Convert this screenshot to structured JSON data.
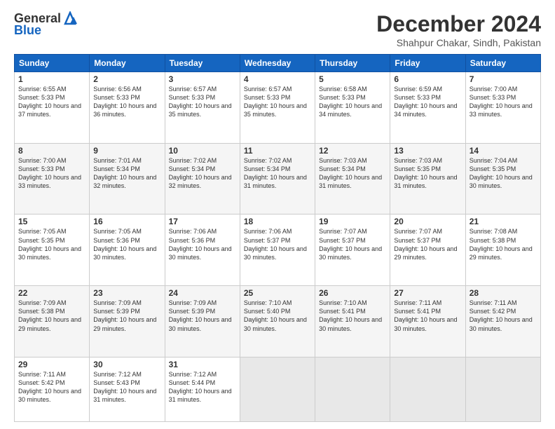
{
  "header": {
    "logo_general": "General",
    "logo_blue": "Blue",
    "month": "December 2024",
    "location": "Shahpur Chakar, Sindh, Pakistan"
  },
  "days_of_week": [
    "Sunday",
    "Monday",
    "Tuesday",
    "Wednesday",
    "Thursday",
    "Friday",
    "Saturday"
  ],
  "weeks": [
    [
      {
        "day": "1",
        "sunrise": "6:55 AM",
        "sunset": "5:33 PM",
        "daylight": "10 hours and 37 minutes."
      },
      {
        "day": "2",
        "sunrise": "6:56 AM",
        "sunset": "5:33 PM",
        "daylight": "10 hours and 36 minutes."
      },
      {
        "day": "3",
        "sunrise": "6:57 AM",
        "sunset": "5:33 PM",
        "daylight": "10 hours and 35 minutes."
      },
      {
        "day": "4",
        "sunrise": "6:57 AM",
        "sunset": "5:33 PM",
        "daylight": "10 hours and 35 minutes."
      },
      {
        "day": "5",
        "sunrise": "6:58 AM",
        "sunset": "5:33 PM",
        "daylight": "10 hours and 34 minutes."
      },
      {
        "day": "6",
        "sunrise": "6:59 AM",
        "sunset": "5:33 PM",
        "daylight": "10 hours and 34 minutes."
      },
      {
        "day": "7",
        "sunrise": "7:00 AM",
        "sunset": "5:33 PM",
        "daylight": "10 hours and 33 minutes."
      }
    ],
    [
      {
        "day": "8",
        "sunrise": "7:00 AM",
        "sunset": "5:33 PM",
        "daylight": "10 hours and 33 minutes."
      },
      {
        "day": "9",
        "sunrise": "7:01 AM",
        "sunset": "5:34 PM",
        "daylight": "10 hours and 32 minutes."
      },
      {
        "day": "10",
        "sunrise": "7:02 AM",
        "sunset": "5:34 PM",
        "daylight": "10 hours and 32 minutes."
      },
      {
        "day": "11",
        "sunrise": "7:02 AM",
        "sunset": "5:34 PM",
        "daylight": "10 hours and 31 minutes."
      },
      {
        "day": "12",
        "sunrise": "7:03 AM",
        "sunset": "5:34 PM",
        "daylight": "10 hours and 31 minutes."
      },
      {
        "day": "13",
        "sunrise": "7:03 AM",
        "sunset": "5:35 PM",
        "daylight": "10 hours and 31 minutes."
      },
      {
        "day": "14",
        "sunrise": "7:04 AM",
        "sunset": "5:35 PM",
        "daylight": "10 hours and 30 minutes."
      }
    ],
    [
      {
        "day": "15",
        "sunrise": "7:05 AM",
        "sunset": "5:35 PM",
        "daylight": "10 hours and 30 minutes."
      },
      {
        "day": "16",
        "sunrise": "7:05 AM",
        "sunset": "5:36 PM",
        "daylight": "10 hours and 30 minutes."
      },
      {
        "day": "17",
        "sunrise": "7:06 AM",
        "sunset": "5:36 PM",
        "daylight": "10 hours and 30 minutes."
      },
      {
        "day": "18",
        "sunrise": "7:06 AM",
        "sunset": "5:37 PM",
        "daylight": "10 hours and 30 minutes."
      },
      {
        "day": "19",
        "sunrise": "7:07 AM",
        "sunset": "5:37 PM",
        "daylight": "10 hours and 30 minutes."
      },
      {
        "day": "20",
        "sunrise": "7:07 AM",
        "sunset": "5:37 PM",
        "daylight": "10 hours and 29 minutes."
      },
      {
        "day": "21",
        "sunrise": "7:08 AM",
        "sunset": "5:38 PM",
        "daylight": "10 hours and 29 minutes."
      }
    ],
    [
      {
        "day": "22",
        "sunrise": "7:09 AM",
        "sunset": "5:38 PM",
        "daylight": "10 hours and 29 minutes."
      },
      {
        "day": "23",
        "sunrise": "7:09 AM",
        "sunset": "5:39 PM",
        "daylight": "10 hours and 29 minutes."
      },
      {
        "day": "24",
        "sunrise": "7:09 AM",
        "sunset": "5:39 PM",
        "daylight": "10 hours and 30 minutes."
      },
      {
        "day": "25",
        "sunrise": "7:10 AM",
        "sunset": "5:40 PM",
        "daylight": "10 hours and 30 minutes."
      },
      {
        "day": "26",
        "sunrise": "7:10 AM",
        "sunset": "5:41 PM",
        "daylight": "10 hours and 30 minutes."
      },
      {
        "day": "27",
        "sunrise": "7:11 AM",
        "sunset": "5:41 PM",
        "daylight": "10 hours and 30 minutes."
      },
      {
        "day": "28",
        "sunrise": "7:11 AM",
        "sunset": "5:42 PM",
        "daylight": "10 hours and 30 minutes."
      }
    ],
    [
      {
        "day": "29",
        "sunrise": "7:11 AM",
        "sunset": "5:42 PM",
        "daylight": "10 hours and 30 minutes."
      },
      {
        "day": "30",
        "sunrise": "7:12 AM",
        "sunset": "5:43 PM",
        "daylight": "10 hours and 31 minutes."
      },
      {
        "day": "31",
        "sunrise": "7:12 AM",
        "sunset": "5:44 PM",
        "daylight": "10 hours and 31 minutes."
      },
      null,
      null,
      null,
      null
    ]
  ]
}
